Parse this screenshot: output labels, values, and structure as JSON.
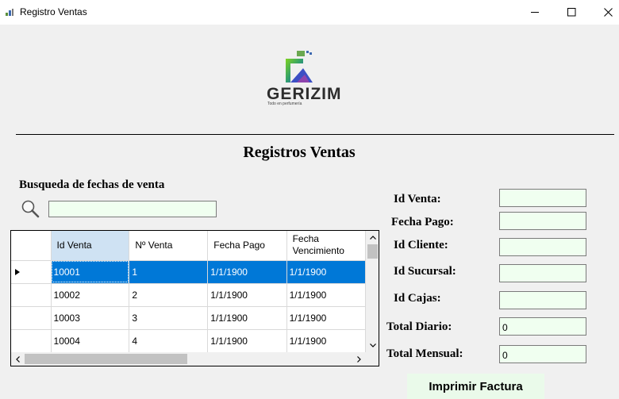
{
  "window": {
    "title": "Registro Ventas",
    "minimize_icon": "minimize-icon",
    "maximize_icon": "maximize-icon",
    "close_icon": "close-icon"
  },
  "logo": {
    "word": "GERIZIM",
    "tagline": "Todo en perfumería"
  },
  "heading": "Registros Ventas",
  "search": {
    "label": "Busqueda de fechas de venta",
    "value": "",
    "icon": "magnifier-icon"
  },
  "grid": {
    "columns": [
      "Id Venta",
      "Nº Venta",
      "Fecha Pago",
      "Fecha Vencimiento"
    ],
    "rows": [
      [
        "10001",
        "1",
        "1/1/1900",
        "1/1/1900"
      ],
      [
        "10002",
        "2",
        "1/1/1900",
        "1/1/1900"
      ],
      [
        "10003",
        "3",
        "1/1/1900",
        "1/1/1900"
      ],
      [
        "10004",
        "4",
        "1/1/1900",
        "1/1/1900"
      ]
    ],
    "selected_row": 0
  },
  "form": {
    "id_venta": {
      "label": "Id Venta:",
      "value": ""
    },
    "fecha_pago": {
      "label": "Fecha Pago:",
      "value": ""
    },
    "id_cliente": {
      "label": "Id Cliente:",
      "value": ""
    },
    "id_sucursal": {
      "label": "Id Sucursal:",
      "value": ""
    },
    "id_cajas": {
      "label": "Id Cajas:",
      "value": ""
    },
    "total_diario": {
      "label": "Total Diario:",
      "value": "0"
    },
    "total_mensual": {
      "label": "Total Mensual:",
      "value": "0"
    }
  },
  "print_button": "Imprimir Factura",
  "colors": {
    "selection": "#0078d7",
    "input_background": "#f0fff0",
    "button_background": "#eafaea"
  }
}
